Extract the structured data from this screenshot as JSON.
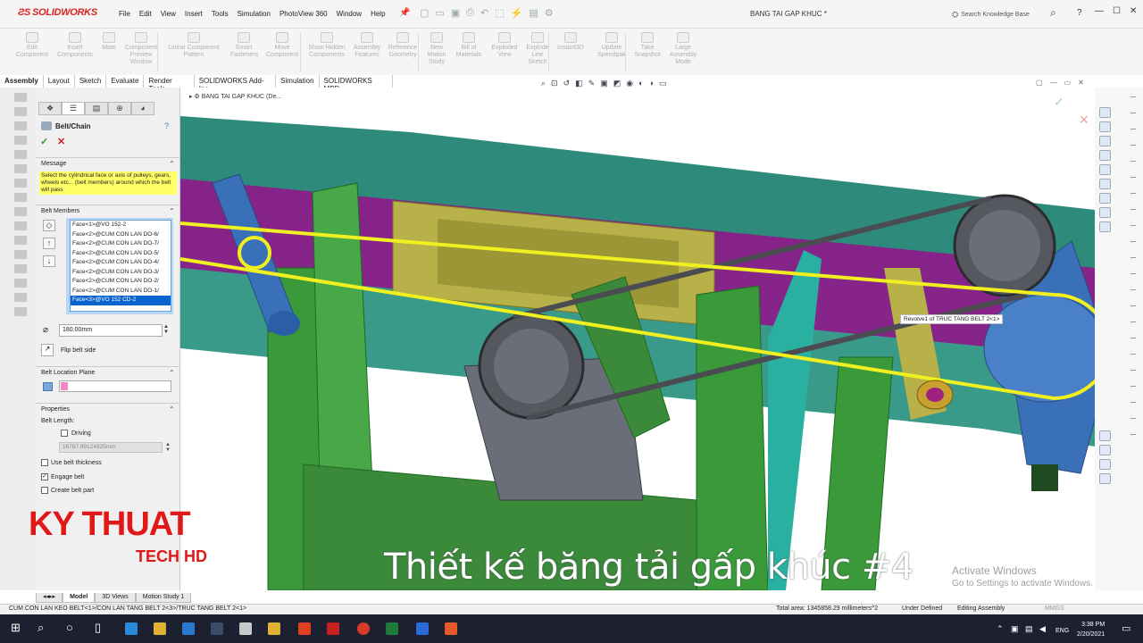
{
  "app": {
    "logo_text": "SOLIDWORKS",
    "document_title": "BANG TAI GAP KHUC *",
    "menu": [
      "File",
      "Edit",
      "View",
      "Insert",
      "Tools",
      "Simulation",
      "PhotoView 360",
      "Window",
      "Help"
    ],
    "search_placeholder": "Search Knowledge Base",
    "help_label": "?",
    "window_controls": [
      "—",
      "☐",
      "✕"
    ]
  },
  "commands": [
    {
      "label": "Edit Component",
      "icon": "edit-component-icon"
    },
    {
      "label": "Insert Components",
      "icon": "insert-components-icon"
    },
    {
      "label": "Mate",
      "icon": "mate-icon"
    },
    {
      "label": "Component Preview Window",
      "icon": "preview-window-icon"
    },
    {
      "label": "Linear Component Pattern",
      "icon": "linear-pattern-icon"
    },
    {
      "label": "Smart Fasteners",
      "icon": "fasteners-icon"
    },
    {
      "label": "Move Component",
      "icon": "move-component-icon"
    },
    {
      "label": "Show Hidden Components",
      "icon": "show-hidden-icon"
    },
    {
      "label": "Assembly Features",
      "icon": "assembly-features-icon"
    },
    {
      "label": "Reference Geometry",
      "icon": "reference-geometry-icon"
    },
    {
      "label": "New Motion Study",
      "icon": "motion-study-icon"
    },
    {
      "label": "Bill of Materials",
      "icon": "bom-icon"
    },
    {
      "label": "Exploded View",
      "icon": "exploded-view-icon"
    },
    {
      "label": "Explode Line Sketch",
      "icon": "explode-line-icon"
    },
    {
      "label": "Instant3D",
      "icon": "instant3d-icon"
    },
    {
      "label": "Update Speedpak",
      "icon": "speedpak-icon"
    },
    {
      "label": "Take Snapshot",
      "icon": "snapshot-icon"
    },
    {
      "label": "Large Assembly Mode",
      "icon": "large-assembly-icon"
    }
  ],
  "tabs": [
    "Assembly",
    "Layout",
    "Sketch",
    "Evaluate",
    "Render Tools",
    "SOLIDWORKS Add-Ins",
    "Simulation",
    "SOLIDWORKS MBD"
  ],
  "active_tab": "Assembly",
  "property_manager": {
    "title": "Belt/Chain",
    "message_header": "Message",
    "message_text": "Select the cylindrical face or axis of pulleys, gears, wheels etc... (belt members) around which the belt will pass",
    "belt_members_header": "Belt Members",
    "belt_members": [
      "Face<1>@VO 152-2",
      "Face<2>@CUM CON LAN DO-6/",
      "Face<2>@CUM CON LAN DO-7/",
      "Face<2>@CUM CON LAN DO-5/",
      "Face<2>@CUM CON LAN DO-4/",
      "Face<2>@CUM CON LAN DO-3/",
      "Face<2>@CUM CON LAN DO-2/",
      "Face<2>@CUM CON LAN DO-1/",
      "Face<3>@VO 152 CD-2"
    ],
    "selected_member_index": 8,
    "diameter_value": "180.00mm",
    "flip_label": "Flip belt side",
    "location_plane_header": "Belt Location Plane",
    "properties_header": "Properties",
    "belt_length_label": "Belt Length:",
    "driving_label": "Driving",
    "driving_checked": false,
    "belt_length_value": "16787.99124925mm",
    "use_thickness_label": "Use belt thickness",
    "use_thickness_checked": false,
    "engage_label": "Engage belt",
    "engage_checked": true,
    "create_part_label": "Create belt part",
    "create_part_checked": false
  },
  "viewport": {
    "breadcrumb": "BANG TAI GAP KHUC  (De...",
    "tooltip": "Revolve1 of TRUC TANG BELT 2<1>",
    "caption": "Thiết kế băng tải gấp khúc #4",
    "brand_line1": "KY THUAT",
    "brand_line2": "TECH HD",
    "activate_title": "Activate Windows",
    "activate_sub": "Go to Settings to activate Windows.",
    "colors": {
      "frame_green": "#3a9a3a",
      "frame_teal": "#2a8a7a",
      "belt_yellow": "#f0f020",
      "purple": "#8a1e8a",
      "roller_blue": "#3a70b8",
      "motor_gray": "#6a6e78"
    }
  },
  "bottom_tabs": [
    "Model",
    "3D Views",
    "Motion Study 1"
  ],
  "active_bottom_tab": "Model",
  "status": {
    "path": "CUM CON LAN KEO BELT<1>/CON LAN TANG BELT 2<3>/TRUC TANG BELT 2<1>",
    "area": "Total area: 1345858.29 millimeters^2",
    "defined": "Under Defined",
    "mode": "Editing Assembly",
    "units": "MMGS"
  },
  "taskbar": {
    "time": "3:38 PM",
    "date": "2/20/2021",
    "lang": "ENG"
  }
}
